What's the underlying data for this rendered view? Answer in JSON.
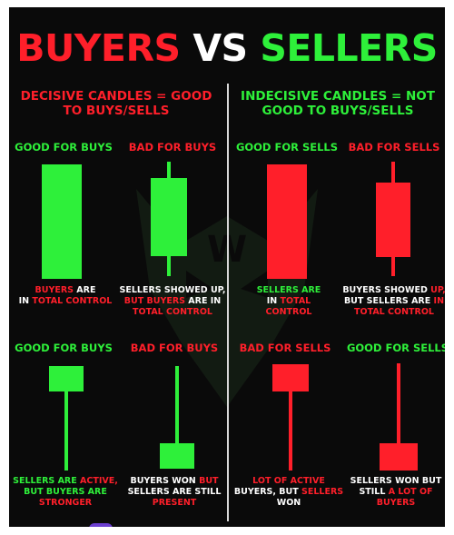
{
  "title": {
    "part1": "BUYERS",
    "part2": "VS",
    "part3": "SELLERS"
  },
  "left_header": "DECISIVE CANDLES = GOOD TO BUYS/SELLS",
  "right_header": "INDECISIVE CANDLES = NOT GOOD TO BUYS/SELLS",
  "row1": {
    "c1": {
      "label": "GOOD FOR BUYS",
      "d": [
        "BUYERS",
        " ARE ",
        "IN ",
        "TOTAL CONTROL"
      ]
    },
    "c2": {
      "label": "BAD FOR BUYS",
      "d": [
        "SELLERS SHOWED UP,",
        "BUT ",
        "BUYERS",
        " ARE IN ",
        "TOTAL CONTROL"
      ]
    },
    "c3": {
      "label": "GOOD FOR SELLS",
      "d": [
        "SELLERS ARE",
        "IN ",
        "TOTAL",
        "CONTROL"
      ]
    },
    "c4": {
      "label": "BAD FOR SELLS",
      "d": [
        "BUYERS SHOWED ",
        "UP,",
        "BUT SELLERS ARE ",
        "IN",
        "TOTAL CONTROL"
      ]
    }
  },
  "row2": {
    "c1": {
      "label": "GOOD FOR BUYS",
      "d": [
        "SELLERS ARE ",
        "ACTIVE,",
        "BUT BUYERS ARE",
        "STRONGER"
      ]
    },
    "c2": {
      "label": "BAD FOR BUYS",
      "d": [
        "BUYERS WON ",
        "BUT",
        "SELLERS ARE STILL",
        "PRESENT"
      ]
    },
    "c3": {
      "label": "BAD FOR SELLS",
      "d": [
        "LOT OF ACTIVE",
        "BUYERS, BUT ",
        "SELLERS",
        "WON"
      ]
    },
    "c4": {
      "label": "GOOD FOR SELLS",
      "d": [
        "SELLERS WON BUT",
        "STILL ",
        "A LOT OF",
        "BUYERS"
      ]
    }
  },
  "colors": {
    "bull": "#2ef03a",
    "bear": "#ff1f2a",
    "background": "#0a0a0a"
  },
  "watermark_icon": "wolf-logo-icon"
}
